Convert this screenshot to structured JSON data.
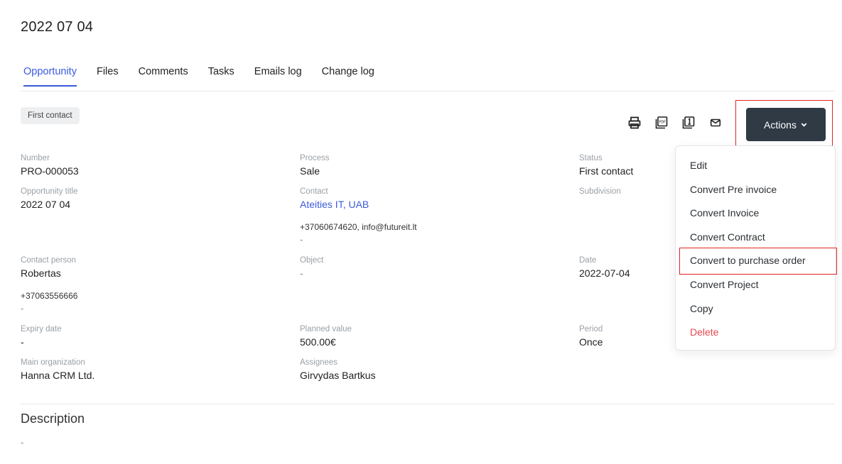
{
  "page": {
    "title": "2022 07 04"
  },
  "tabs": [
    {
      "label": "Opportunity",
      "active": true
    },
    {
      "label": "Files"
    },
    {
      "label": "Comments"
    },
    {
      "label": "Tasks"
    },
    {
      "label": "Emails log"
    },
    {
      "label": "Change log"
    }
  ],
  "stage_badge": "First contact",
  "toolbar": {
    "icons": [
      "print-icon",
      "pdf-icon",
      "copy-one-icon",
      "email-icon"
    ],
    "actions_label": "Actions"
  },
  "actions_menu": {
    "items": [
      {
        "label": "Edit"
      },
      {
        "label": "Convert Pre invoice"
      },
      {
        "label": "Convert Invoice"
      },
      {
        "label": "Convert Contract"
      },
      {
        "label": "Convert to purchase order"
      },
      {
        "label": "Convert Project"
      },
      {
        "label": "Copy"
      },
      {
        "label": "Delete",
        "danger": true
      }
    ]
  },
  "fields": {
    "number": {
      "label": "Number",
      "value": "PRO-000053"
    },
    "process": {
      "label": "Process",
      "value": "Sale"
    },
    "status": {
      "label": "Status",
      "value": "First contact"
    },
    "opportunity_title": {
      "label": "Opportunity title",
      "value": "2022 07 04"
    },
    "contact": {
      "label": "Contact",
      "value": "Ateities IT, UAB",
      "details": "+37060674620, info@futureit.lt",
      "extra": "-"
    },
    "subdivision": {
      "label": "Subdivision"
    },
    "contact_person": {
      "label": "Contact person",
      "value": "Robertas",
      "phone": "+37063556666",
      "extra": "-"
    },
    "object": {
      "label": "Object",
      "value": "-"
    },
    "date": {
      "label": "Date",
      "value": "2022-07-04"
    },
    "expiry_date": {
      "label": "Expiry date",
      "value": "-"
    },
    "planned_value": {
      "label": "Planned value",
      "value": "500.00€"
    },
    "period": {
      "label": "Period",
      "value": "Once"
    },
    "main_organization": {
      "label": "Main organization",
      "value": "Hanna CRM Ltd."
    },
    "assignees": {
      "label": "Assignees",
      "value": "Girvydas Bartkus"
    }
  },
  "description": {
    "title": "Description",
    "value": "-"
  },
  "colors": {
    "accent": "#3b5bdb",
    "actions_bg": "#2f3a45",
    "highlight": "#e02424",
    "danger": "#e5484d"
  }
}
